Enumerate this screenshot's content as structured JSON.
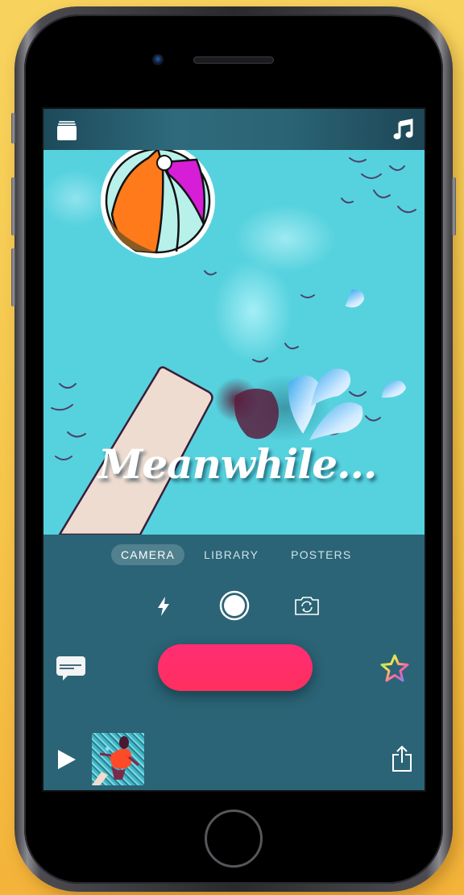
{
  "device": {
    "model": "iPhone",
    "background_colors": [
      "#f7d35e",
      "#f4b33a"
    ]
  },
  "topbar": {
    "left_icon": "projects-stack-icon",
    "right_icon": "music-note-icon"
  },
  "preview": {
    "title_text": "Meanwhile...",
    "stickers": [
      "beach-ball-sticker",
      "water-drops-emoji"
    ]
  },
  "mode_tabs": [
    {
      "label": "CAMERA",
      "active": true
    },
    {
      "label": "LIBRARY",
      "active": false
    },
    {
      "label": "POSTERS",
      "active": false
    }
  ],
  "camera_controls": {
    "flash_icon": "flash-icon",
    "photo_icon": "shutter-icon",
    "flip_icon": "flip-camera-icon"
  },
  "record": {
    "label": "",
    "color": "#ff2d6a"
  },
  "side_buttons": {
    "left_icon": "live-titles-icon",
    "right_icon": "effects-star-icon"
  },
  "bottom_bar": {
    "play_icon": "play-icon",
    "clip_thumbnail": "clip-thumbnail",
    "share_icon": "share-icon"
  },
  "colors": {
    "accent": "#ff2d6a",
    "screen_bg": "#2b6476",
    "water": "#56d2de"
  }
}
